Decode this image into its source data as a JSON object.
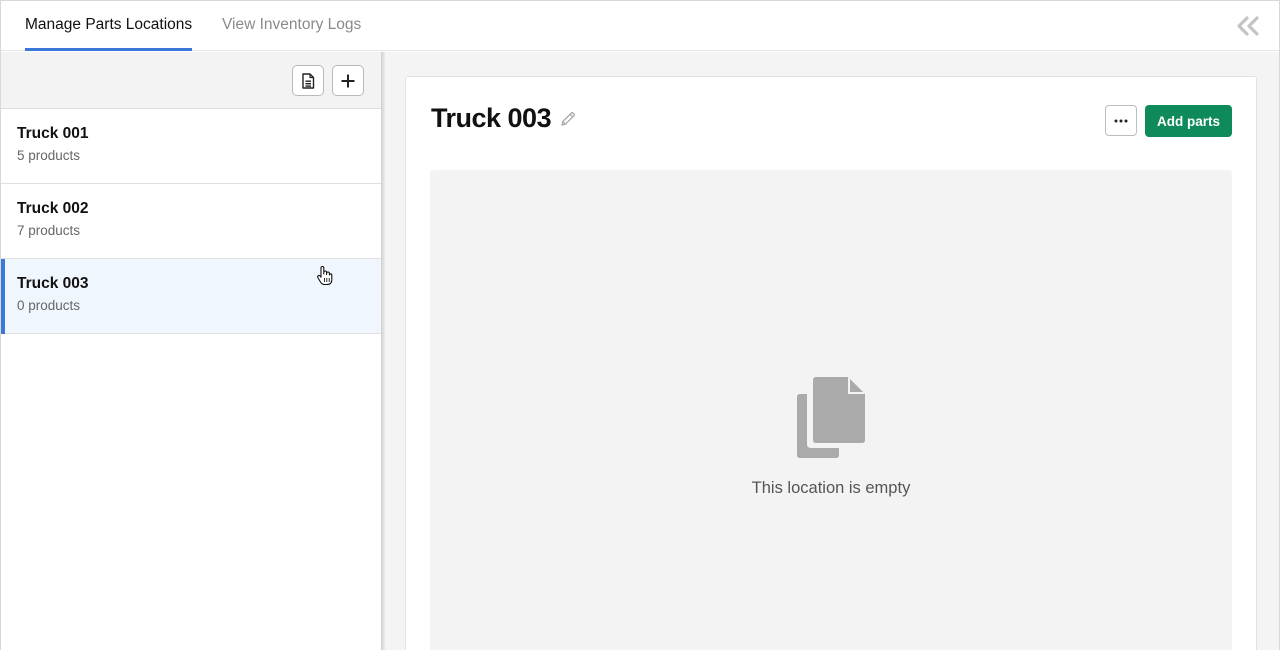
{
  "tabs": {
    "active": "Manage Parts Locations",
    "inactive": "View Inventory Logs"
  },
  "locations": [
    {
      "name": "Truck 001",
      "count": "5 products"
    },
    {
      "name": "Truck 002",
      "count": "7 products"
    },
    {
      "name": "Truck 003",
      "count": "0 products"
    }
  ],
  "selected_index": 2,
  "detail": {
    "title": "Truck 003",
    "more_label": "···",
    "add_parts_label": "Add parts",
    "empty_message": "This location is empty"
  },
  "icons": {
    "collapse": "double-chevron-left-icon",
    "document": "document-icon",
    "add": "plus-icon",
    "edit": "pencil-icon",
    "empty": "documents-icon"
  },
  "colors": {
    "accent": "#3b78d8",
    "primary_button": "#0f8a5a",
    "selected_row": "#f0f6fe",
    "empty_icon": "#aaaaaa"
  }
}
